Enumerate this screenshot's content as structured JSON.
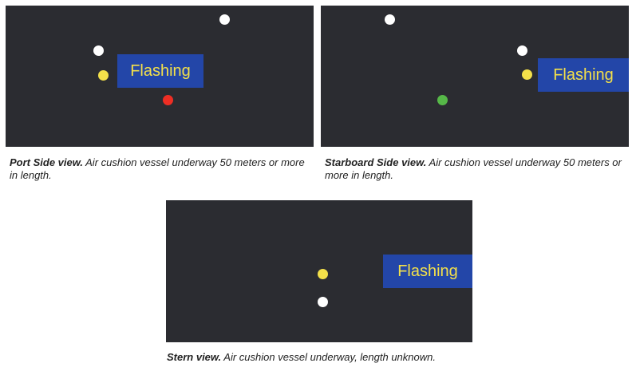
{
  "panels": {
    "port": {
      "flash_label": "Flashing",
      "caption_title": "Port Side view.",
      "caption_text": " Air cushion vessel underway 50 meters or more in length.",
      "lights": [
        "white",
        "white",
        "yellow",
        "red"
      ]
    },
    "starboard": {
      "flash_label": "Flashing",
      "caption_title": "Starboard Side view.",
      "caption_text": " Air cushion vessel underway 50 meters or more in length.",
      "lights": [
        "white",
        "white",
        "yellow",
        "green"
      ]
    },
    "stern": {
      "flash_label": "Flashing",
      "caption_title": "Stern view.",
      "caption_text": " Air cushion vessel underway, length unknown.",
      "lights": [
        "yellow",
        "white"
      ]
    }
  },
  "colors": {
    "panel_background": "#2b2c31",
    "flash_box": "#2346a8",
    "flash_text": "#f3e04a",
    "white_light": "#ffffff",
    "yellow_light": "#f3e04a",
    "red_light": "#ee2e24",
    "green_light": "#56b848"
  }
}
